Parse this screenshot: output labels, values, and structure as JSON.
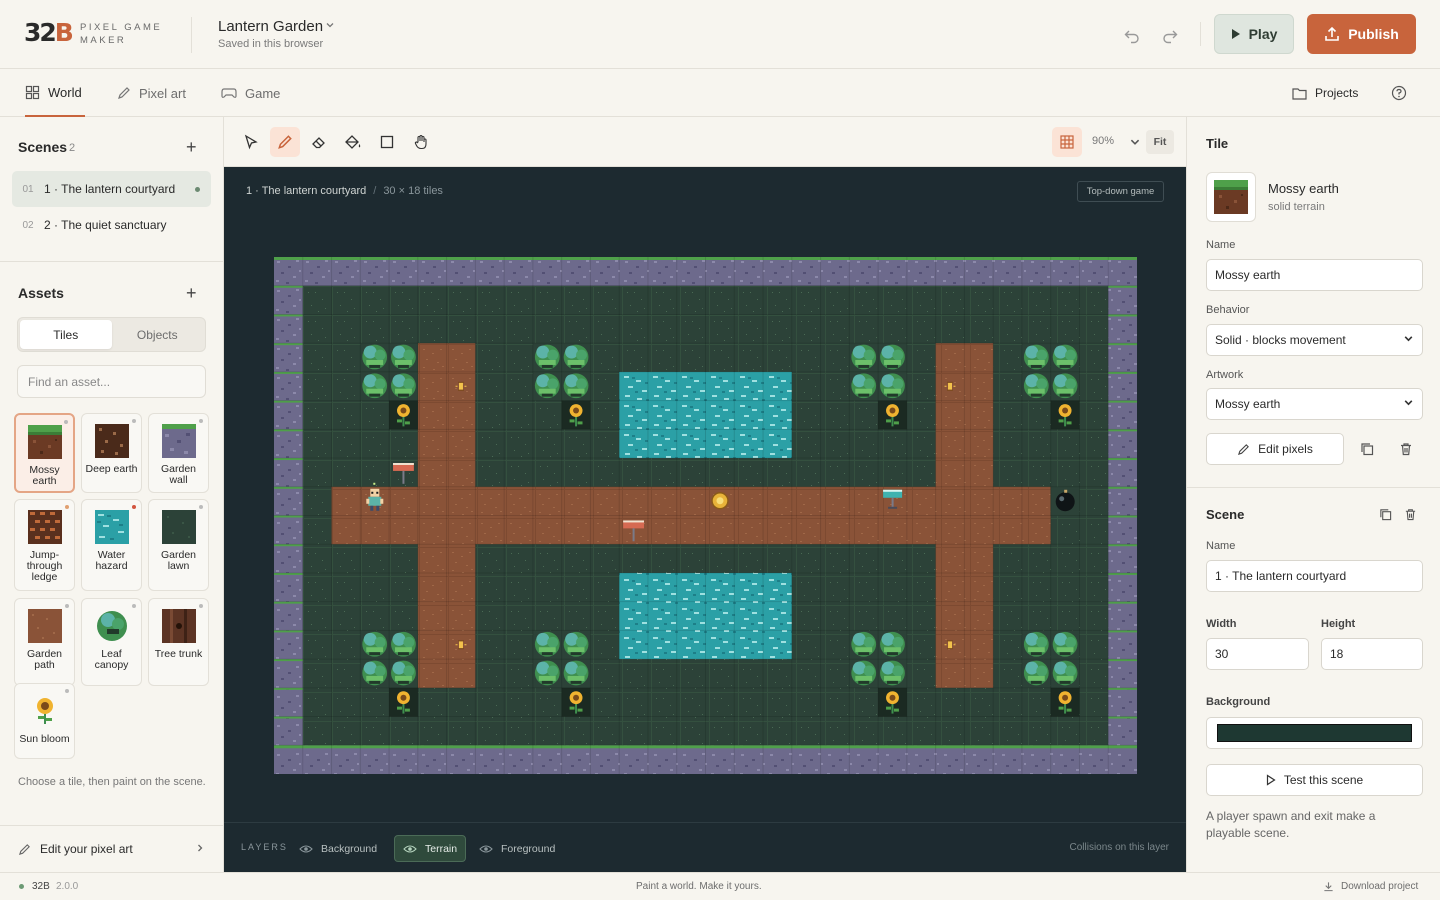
{
  "app": {
    "logo_num": "32",
    "logo_letter": "B",
    "logo_sub": "PIXEL GAME MAKER"
  },
  "project": {
    "title": "Lantern Garden",
    "status": "Saved in this browser"
  },
  "actions": {
    "play": "Play",
    "publish": "Publish"
  },
  "tabs": [
    {
      "label": "World"
    },
    {
      "label": "Pixel art"
    },
    {
      "label": "Game"
    }
  ],
  "top_right": {
    "projects": "Projects"
  },
  "scenes": {
    "title": "Scenes",
    "count": "2",
    "items": [
      {
        "num": "01",
        "label": "1 · The lantern courtyard"
      },
      {
        "num": "02",
        "label": "2 · The quiet sanctuary"
      }
    ]
  },
  "assets": {
    "title": "Assets",
    "seg": [
      "Tiles",
      "Objects"
    ],
    "search_placeholder": "Find an asset...",
    "items": [
      {
        "label": "Mossy earth"
      },
      {
        "label": "Deep earth"
      },
      {
        "label": "Garden wall"
      },
      {
        "label": "Jump-through ledge"
      },
      {
        "label": "Water hazard"
      },
      {
        "label": "Garden lawn"
      },
      {
        "label": "Garden path"
      },
      {
        "label": "Leaf canopy"
      },
      {
        "label": "Tree trunk"
      },
      {
        "label": "Sun bloom"
      }
    ],
    "hint": "Choose a tile, then paint on the scene.",
    "edit_pixel_art": "Edit your pixel art"
  },
  "toolbar": {
    "zoom": "90%",
    "fit": "Fit"
  },
  "canvas": {
    "scene_name": "1 · The lantern courtyard",
    "scene_size": "30 × 18 tiles",
    "mode": "Top-down game",
    "grid_cols": 30,
    "grid_rows": 18
  },
  "layers": {
    "label": "LAYERS",
    "items": [
      "Background",
      "Terrain",
      "Foreground"
    ],
    "note": "Collisions on this layer"
  },
  "tile_panel": {
    "title": "Tile",
    "name": "Mossy earth",
    "kind": "solid terrain",
    "name_label": "Name",
    "name_value": "Mossy earth",
    "behavior_label": "Behavior",
    "behavior_value": "Solid · blocks movement",
    "artwork_label": "Artwork",
    "artwork_value": "Mossy earth",
    "edit_pixels": "Edit pixels"
  },
  "scene_panel": {
    "title": "Scene",
    "name_label": "Name",
    "name_value": "1 · The lantern courtyard",
    "width_label": "Width",
    "width_value": "30",
    "height_label": "Height",
    "height_value": "18",
    "background_label": "Background",
    "background_color": "#1e3832",
    "test": "Test this scene",
    "note": "A player spawn and exit make a playable scene."
  },
  "status": {
    "app": "32B",
    "version": "2.0.0",
    "tagline": "Paint a world. Make it yours.",
    "download": "Download project"
  },
  "colors": {
    "accent": "#c8643c",
    "stage": "#1d2a30",
    "lawn": "#2c4238",
    "path": "#8a5338",
    "water": "#2ba0a6",
    "wall": "#6d6a8c"
  }
}
